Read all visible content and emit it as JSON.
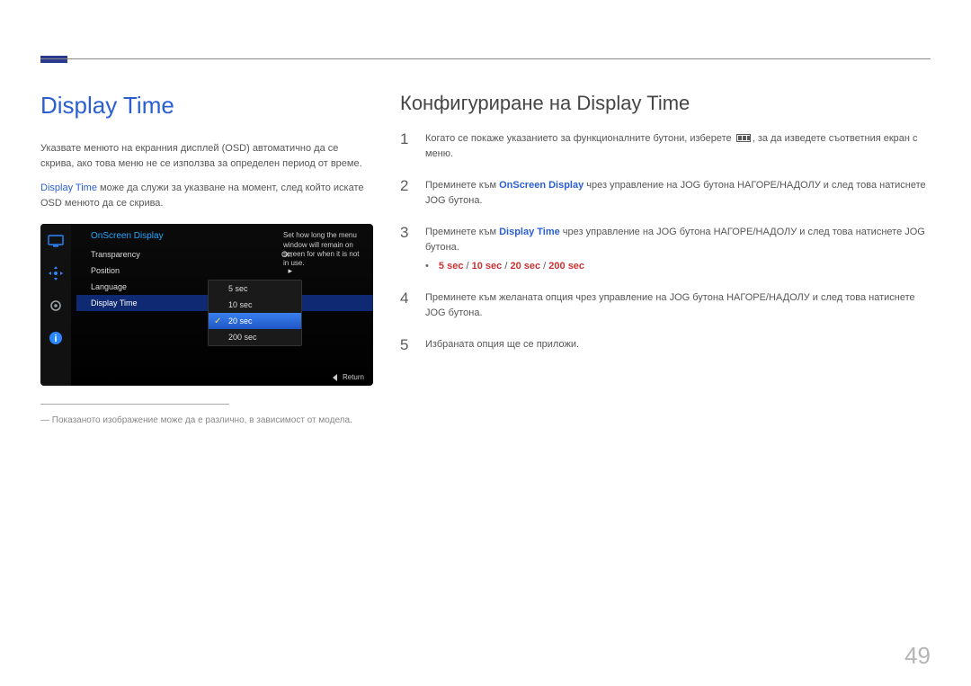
{
  "page_number": "49",
  "left": {
    "heading": "Display Time",
    "para1": "Указвате менюто на екранния дисплей (OSD) автоматично да се скрива, ако това меню не се използва за определен период от време.",
    "para2_lead": "Display Time",
    "para2_rest": " може да служи за указване на момент, след който искате OSD менюто да се скрива.",
    "footnote": "Показаното изображение може да е различно, в зависимост от модела."
  },
  "osd": {
    "title": "OnScreen Display",
    "items": [
      {
        "label": "Transparency",
        "value": "On"
      },
      {
        "label": "Position",
        "value": "▸"
      },
      {
        "label": "Language",
        "value": "▸"
      },
      {
        "label": "Display Time",
        "value": ""
      }
    ],
    "tray": [
      "5 sec",
      "10 sec",
      "20 sec",
      "200 sec"
    ],
    "tray_selected": "20 sec",
    "desc": "Set how long the menu window will remain on screen for when it is not in use.",
    "return": "Return"
  },
  "right": {
    "heading": "Конфигуриране на Display Time",
    "steps": {
      "s1a": "Когато се покаже указанието за функционалните бутони, изберете ",
      "s1b": ", за да изведете съответния екран с меню.",
      "s2a": "Преминете към ",
      "s2k": "OnScreen Display",
      "s2b": " чрез управление на JOG бутона НАГОРЕ/НАДОЛУ и след това натиснете JOG бутона.",
      "s3a": "Преминете към ",
      "s3k": "Display Time",
      "s3b": " чрез управление на JOG бутона НАГОРЕ/НАДОЛУ и след това натиснете JOG бутона.",
      "opts": [
        "5 sec",
        "10 sec",
        "20 sec",
        "200 sec"
      ],
      "s4": "Преминете към желаната опция чрез управление на JOG бутона НАГОРЕ/НАДОЛУ и след това натиснете JOG бутона.",
      "s5": "Избраната опция ще се приложи."
    }
  }
}
